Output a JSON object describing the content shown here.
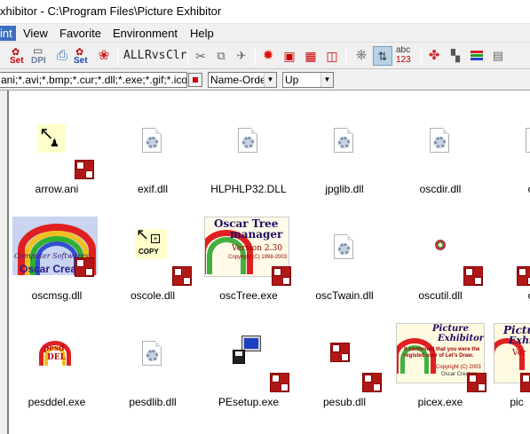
{
  "window": {
    "title": "xhibitor - C:\\Program Files\\Picture Exhibitor"
  },
  "menu": [
    {
      "label": "int",
      "active": true
    },
    {
      "label": "View"
    },
    {
      "label": "Favorite"
    },
    {
      "label": "Environment"
    },
    {
      "label": "Help"
    }
  ],
  "toolbar": {
    "set_label": "Set",
    "dpi_label": "DPI",
    "set2_label": "Set",
    "all_label": "ALL",
    "rvs_label": "Rvs",
    "clr_label": "Clr",
    "abc_label": "abc",
    "num_label": "123"
  },
  "filter": {
    "extensions": "ani;*.avi;*.bmp;*.cur;*.dll;*.exe;*.gif;*.ico;*.j2k;",
    "sort_field": "Name-Order",
    "sort_dir": "Up"
  },
  "thumb_text": {
    "computer": "Computer Softwares",
    "oscar": "Oscar Creati",
    "copy": "COPY",
    "tree_title": "Oscar Tree",
    "tree_title2": "manager",
    "tree_ver": "Version 2.30",
    "tree_copy": "Copyright (C) 1998-2003",
    "pesd": "pesd",
    "del": "DEL",
    "pic_title": "Picture",
    "pic_title2": "Exhibitor",
    "pic_msg": "It confirmed that you were the registed user of Let's Draw.",
    "pic_copy": "Copyright (C) 2003",
    "pic_by": "Oscar Creation",
    "pict": "Pictu",
    "exhib": "Exhi",
    "ver": "Ver"
  },
  "files": [
    {
      "name": "arrow.ani"
    },
    {
      "name": "exif.dll"
    },
    {
      "name": "HLPHLP32.DLL"
    },
    {
      "name": "jpglib.dll"
    },
    {
      "name": "oscdir.dll"
    },
    {
      "name": "osc"
    },
    {
      "name": "oscmsg.dll"
    },
    {
      "name": "oscole.dll"
    },
    {
      "name": "oscTree.exe"
    },
    {
      "name": "oscTwain.dll"
    },
    {
      "name": "oscutil.dll"
    },
    {
      "name": "osc"
    },
    {
      "name": "pesddel.exe"
    },
    {
      "name": "pesdlib.dll"
    },
    {
      "name": "PEsetup.exe"
    },
    {
      "name": "pesub.dll"
    },
    {
      "name": "picex.exe"
    },
    {
      "name": "pic"
    }
  ],
  "colors": {
    "accent": "#3d6fc1",
    "tag": "#b01818"
  }
}
